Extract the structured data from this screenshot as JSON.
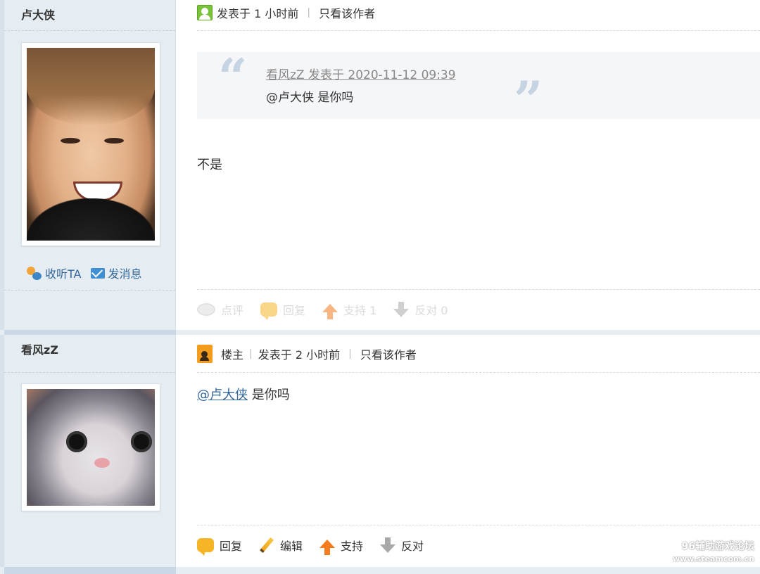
{
  "posts": [
    {
      "username": "卢大侠",
      "side_actions": {
        "follow": "收听TA",
        "message": "发消息"
      },
      "meta": {
        "posted": "发表于 1 小时前",
        "author_only": "只看该作者"
      },
      "quote": {
        "header": "看风zZ 发表于 2020-11-12 09:39",
        "body": "@卢大侠 是你吗"
      },
      "content": "不是",
      "footer": {
        "comment": "点评",
        "reply": "回复",
        "support": "支持 1",
        "oppose": "反对 0"
      }
    },
    {
      "username": "看风zZ",
      "meta": {
        "host": "楼主",
        "posted": "发表于 2 小时前",
        "author_only": "只看该作者"
      },
      "content_mention": "@卢大侠",
      "content_rest": " 是你吗",
      "footer": {
        "reply": "回复",
        "edit": "编辑",
        "support": "支持",
        "oppose": "反对"
      }
    }
  ],
  "watermark": {
    "line1": "96辅助游戏论坛",
    "line2": "www.steamcom.cn"
  },
  "colors": {
    "side_bg": "#e5edf2",
    "link": "#336699",
    "accent": "#f39c1e"
  }
}
